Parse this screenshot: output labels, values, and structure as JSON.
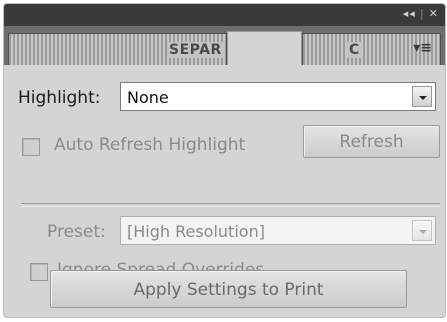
{
  "window": {
    "collapse_glyph": "◂◂",
    "close_glyph": "✕"
  },
  "tabs": [
    {
      "label": "SEPAR"
    },
    {
      "label": ""
    },
    {
      "label": "C"
    }
  ],
  "tab_menu_icon": "menu-icon",
  "highlight": {
    "label": "Highlight:",
    "value": "None"
  },
  "auto_refresh": {
    "label": "Auto Refresh Highlight",
    "checked": false
  },
  "refresh_button": {
    "label": "Refresh"
  },
  "preset": {
    "label": "Preset:",
    "value": "[High Resolution]"
  },
  "ignore_spread": {
    "label": "Ignore Spread Overrides",
    "checked": false
  },
  "apply_button": {
    "label": "Apply Settings to Print"
  },
  "colors": {
    "panel_bg": "#d4d4d4",
    "titlebar_bg": "#3a3a3a",
    "tabbar_bg": "#6d6d6d"
  }
}
